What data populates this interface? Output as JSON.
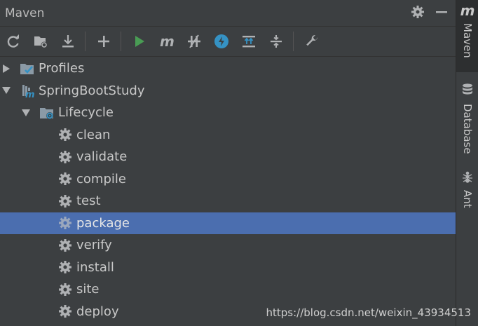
{
  "panel": {
    "title": "Maven",
    "header_icons": [
      "gear-icon",
      "minimize-icon"
    ]
  },
  "toolbar": {
    "buttons": [
      {
        "name": "reload-all-projects",
        "icon": "refresh-icon"
      },
      {
        "name": "generate-sources",
        "icon": "folder-refresh-icon"
      },
      {
        "name": "download-sources",
        "icon": "download-icon"
      },
      {
        "name": "add-maven-project",
        "icon": "plus-icon"
      },
      {
        "name": "run-maven-build",
        "icon": "play-icon"
      },
      {
        "name": "execute-maven-goal",
        "icon": "maven-m-icon"
      },
      {
        "name": "toggle-offline-mode",
        "icon": "offline-icon"
      },
      {
        "name": "skip-tests",
        "icon": "skip-tests-icon"
      },
      {
        "name": "show-dependencies",
        "icon": "dependencies-icon"
      },
      {
        "name": "collapse-all",
        "icon": "collapse-icon"
      },
      {
        "name": "maven-settings",
        "icon": "wrench-icon"
      }
    ]
  },
  "tree": {
    "profiles": "Profiles",
    "project": "SpringBootStudy",
    "lifecycle": "Lifecycle",
    "goals": [
      "clean",
      "validate",
      "compile",
      "test",
      "package",
      "verify",
      "install",
      "site",
      "deploy"
    ],
    "selected_goal": "package"
  },
  "right_strip": {
    "tabs": [
      "Maven",
      "Database",
      "Ant"
    ],
    "maven_icon_letter": "m",
    "active": "Maven"
  },
  "watermark": "https://blog.csdn.net/weixin_43934513",
  "colors": {
    "background": "#3c3f41",
    "selection": "#4b6eaf",
    "run_green": "#499c54",
    "accent_blue": "#3592c4"
  }
}
